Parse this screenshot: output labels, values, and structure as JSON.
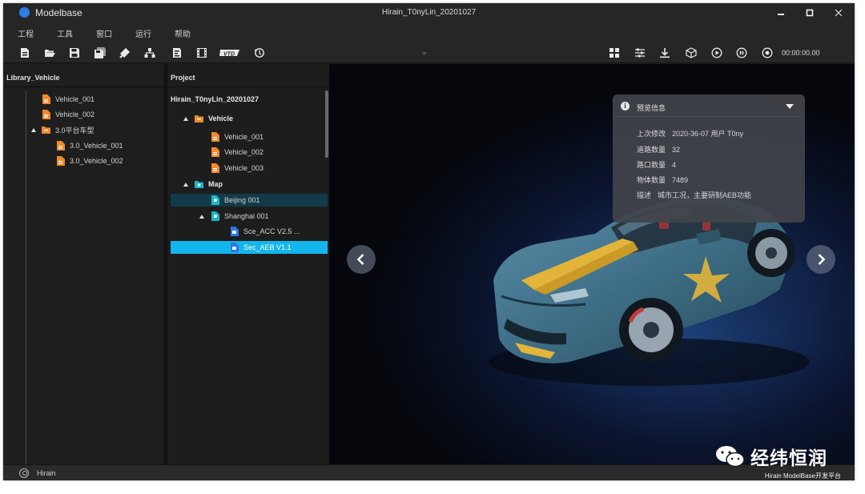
{
  "titlebar": {
    "app_name": "Modelbase",
    "window_title": "Hirain_T0nyLin_20201027"
  },
  "menu": [
    "工程",
    "工具",
    "窗口",
    "运行",
    "帮助"
  ],
  "toolbar": {
    "left_icons": [
      "new-file-icon",
      "open-folder-icon",
      "save-icon",
      "save-as-icon",
      "build-icon",
      "hierarchy-icon",
      "report-icon",
      "film-icon",
      "vtd-icon",
      "history-icon"
    ],
    "vtd_label": "VTD",
    "right_icons": [
      "grid-icon",
      "sliders-icon",
      "download-icon",
      "cube-icon",
      "play-icon",
      "stop-icon",
      "record-icon"
    ],
    "timer": "00:00:00.00"
  },
  "library": {
    "title": "Library_Vehicle",
    "items": [
      {
        "label": "Vehicle_001"
      },
      {
        "label": "Vehicle_002"
      },
      {
        "label": "3.0平台车型"
      },
      {
        "label": "3.0_Vehicle_001"
      },
      {
        "label": "3.0_Vehicle_002"
      }
    ]
  },
  "project": {
    "title": "Project",
    "root": "Hirain_T0nyLin_20201027",
    "items": [
      {
        "label": "Vehicle"
      },
      {
        "label": "Vehicle_001"
      },
      {
        "label": "Vehicle_002"
      },
      {
        "label": "Vehicle_003"
      },
      {
        "label": "Map"
      },
      {
        "label": "Beijing 001"
      },
      {
        "label": "Shanghai 001"
      },
      {
        "label": "Sce_ACC V2.5 ..."
      },
      {
        "label": "Sec_AEB V1.1"
      }
    ]
  },
  "info": {
    "title": "预览信息",
    "rows": [
      {
        "key": "上次修改",
        "value": "2020-36-07  用户  T0ny"
      },
      {
        "key": "道路数量",
        "value": "32"
      },
      {
        "key": "路口数量",
        "value": "4"
      },
      {
        "key": "物体数量",
        "value": "7489"
      },
      {
        "key": "描述",
        "value": "城市工况，主要研制AEB功能"
      }
    ]
  },
  "rail_icons": [
    "car-icon",
    "map-icon",
    "layers-icon",
    "collapse-icon"
  ],
  "status": {
    "user": "Hirain"
  },
  "watermark": {
    "title": "经纬恒润",
    "subtitle": "Hirain  ModelBase开发平台"
  },
  "colors": {
    "accent": "#13b6ec",
    "selection_dark": "#123a48",
    "vehicle_icon": "#f08a2a",
    "map_icon": "#19b8c8",
    "scene_icon": "#2f74e8"
  }
}
